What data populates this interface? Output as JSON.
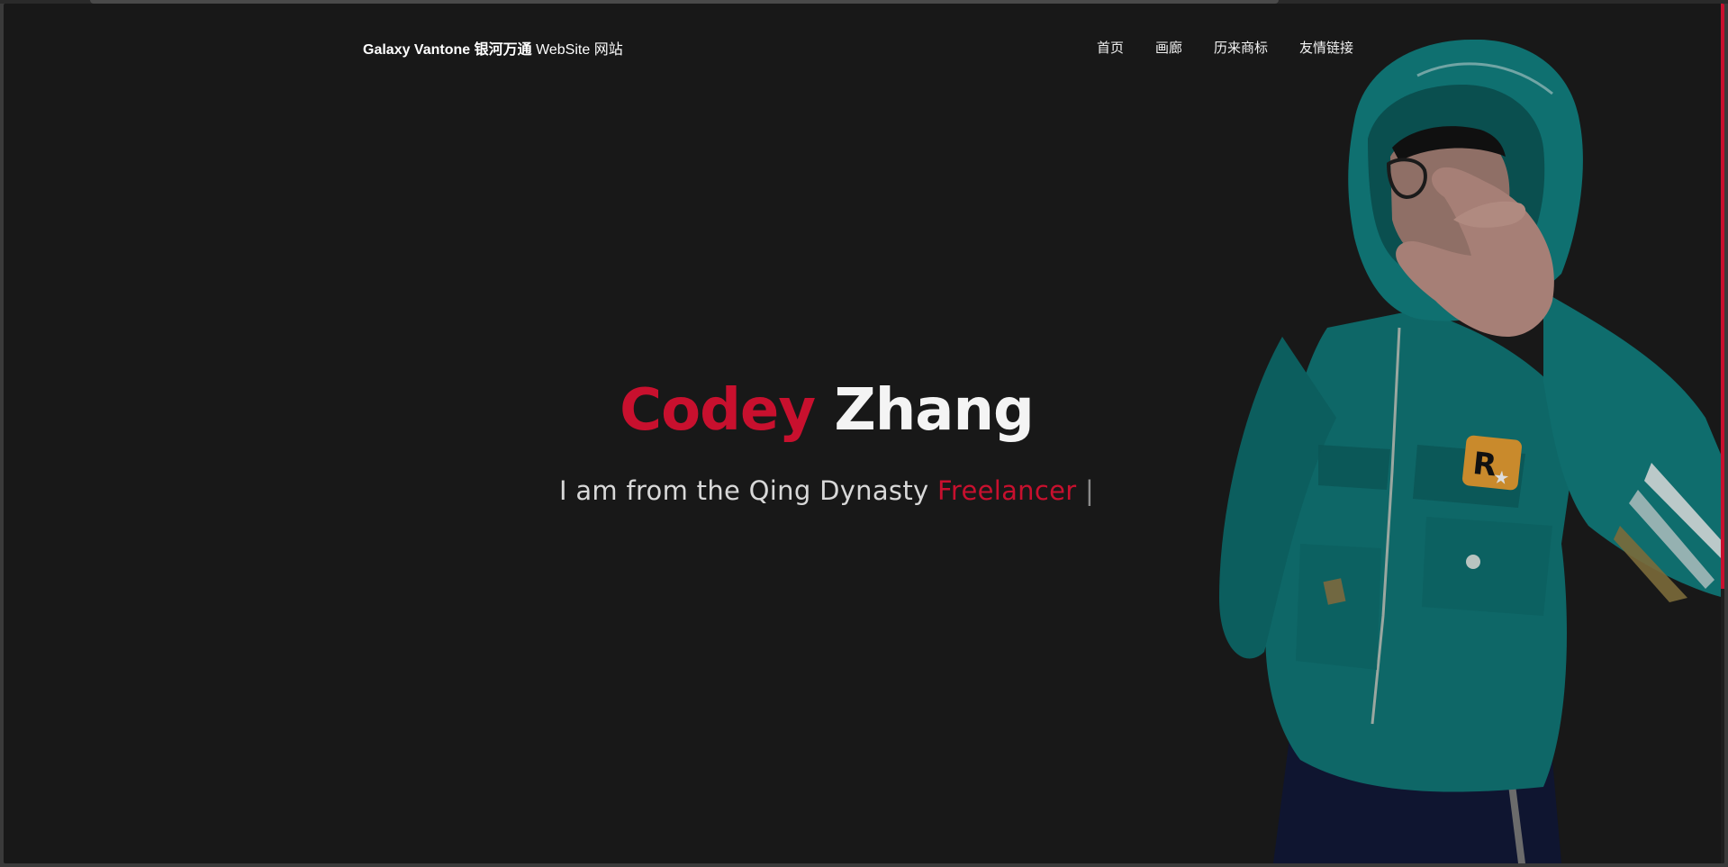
{
  "header": {
    "brand_bold": "Galaxy Vantone 银河万通",
    "brand_light": " WebSite 网站",
    "nav": [
      {
        "label": "首页"
      },
      {
        "label": "画廊"
      },
      {
        "label": "历来商标"
      },
      {
        "label": "友情链接"
      }
    ]
  },
  "hero": {
    "first_name": "Codey",
    "last_name": "Zhang",
    "tagline": "I am from the Qing Dynasty ",
    "role": "Freelancer",
    "cursor": " |"
  },
  "colors": {
    "background": "#181818",
    "accent": "#c8102e",
    "text": "#f4f4f4",
    "jacket": "#0e6b6b"
  },
  "icons": {
    "patch": "rockstar-logo-patch"
  }
}
